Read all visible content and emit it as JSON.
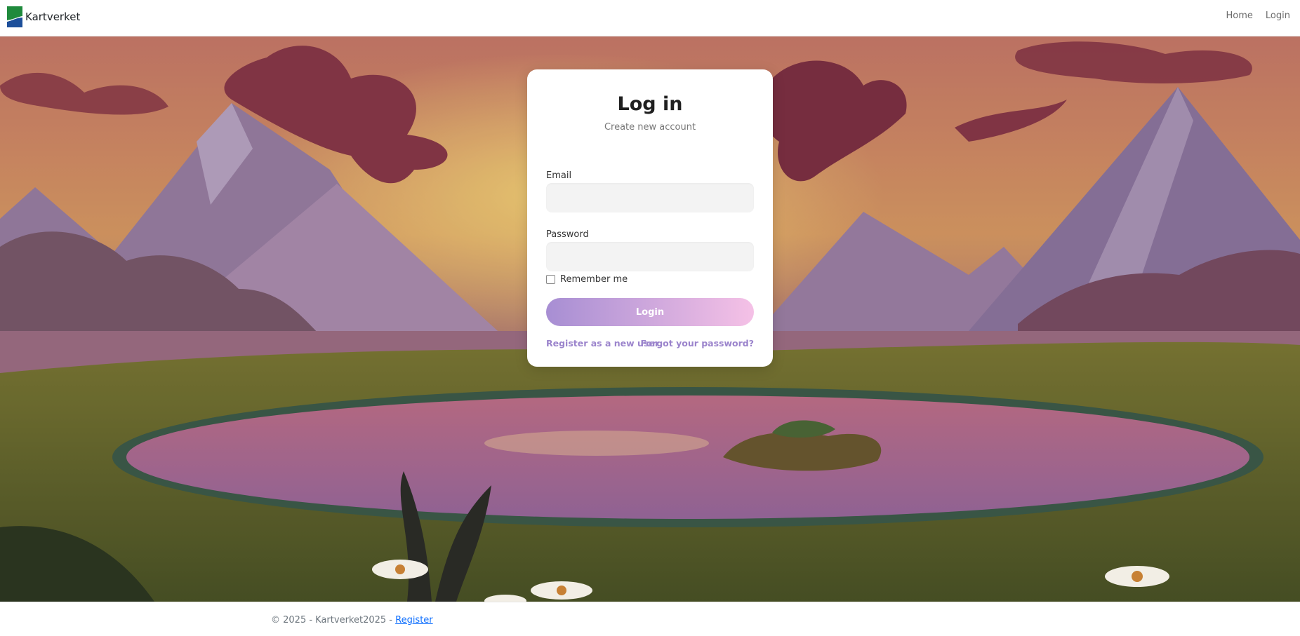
{
  "navbar": {
    "brand": "Kartverket",
    "links": [
      {
        "label": "Home"
      },
      {
        "label": "Login"
      }
    ]
  },
  "login_card": {
    "title": "Log in",
    "subtitle": "Create new account",
    "email_label": "Email",
    "email_value": "",
    "password_label": "Password",
    "password_value": "",
    "remember_label": "Remember me",
    "remember_checked": false,
    "login_button": "Login",
    "register_link": "Register as a new user",
    "forgot_link": "Forgot your password?"
  },
  "footer": {
    "copyright": "© 2025 - Kartverket2025 - ",
    "register_link": "Register"
  },
  "colors": {
    "button_gradient_start": "#a78ed3",
    "button_gradient_end": "#f5c1e6",
    "link": "#9b84cc",
    "footer_link": "#0d6efd"
  }
}
